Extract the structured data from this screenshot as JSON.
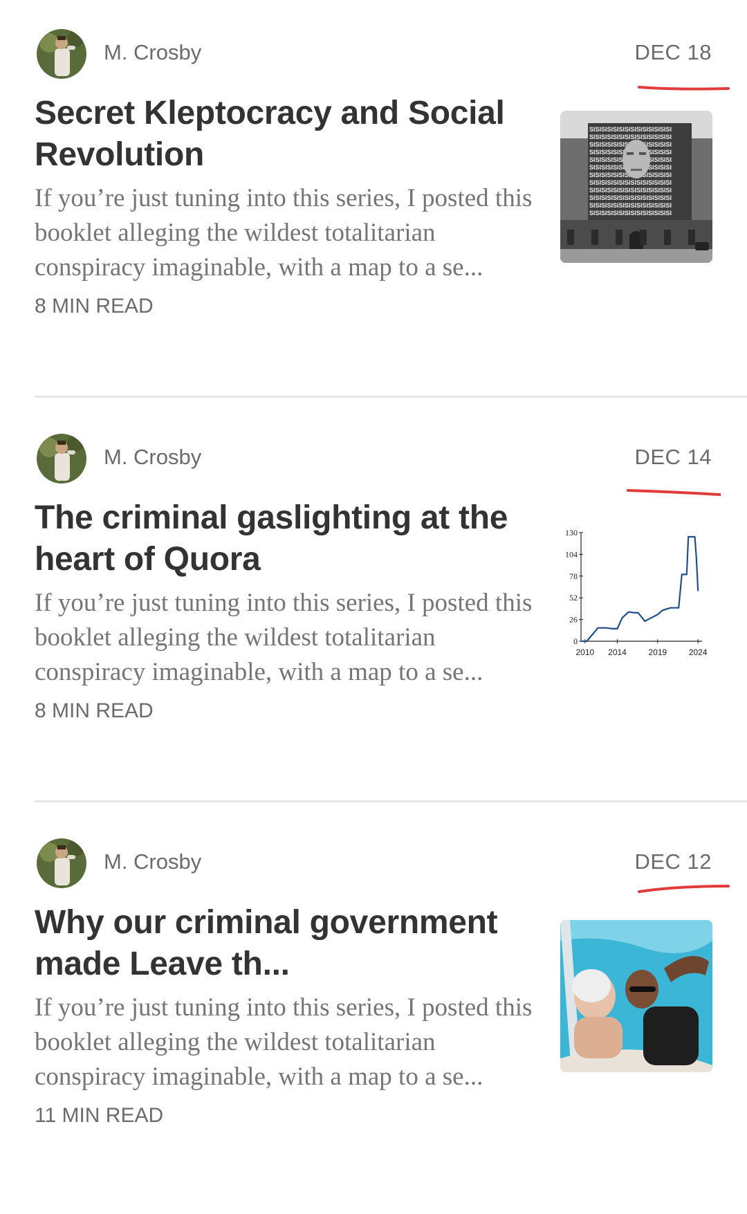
{
  "feed": {
    "posts": [
      {
        "author": "M. Crosby",
        "date": "DEC 18",
        "title": "Secret Kleptocracy and Social Revolution",
        "excerpt": "If you’re just tuning into this series, I posted this booklet alleging the wildest totalitarian conspiracy imaginable, with a map to a se...",
        "read_time": "8 MIN READ",
        "thumbnail_icon": "building-facade-photo"
      },
      {
        "author": "M. Crosby",
        "date": "DEC 14",
        "title": "The criminal gaslighting at the heart of Quora",
        "excerpt": "If you’re just tuning into this series, I posted this booklet alleging the wildest totalitarian conspiracy imaginable, with a map to a se...",
        "read_time": "8 MIN READ",
        "thumbnail_icon": "line-chart"
      },
      {
        "author": "M. Crosby",
        "date": "DEC 12",
        "title": "Why our criminal government made Leave th...",
        "excerpt": "If you’re just tuning into this series, I posted this booklet alleging the wildest totalitarian conspiracy imaginable, with a map to a se...",
        "read_time": "11 MIN READ",
        "thumbnail_icon": "people-in-pool-photo"
      }
    ]
  },
  "building_facade_text": "SI",
  "annotation_color": "#e23b3b",
  "chart_data": {
    "type": "line",
    "title": "",
    "xlabel": "",
    "ylabel": "",
    "x_ticks": [
      "2010",
      "2014",
      "2019",
      "2024"
    ],
    "y_ticks": [
      "0",
      "26",
      "52",
      "78",
      "104",
      "130"
    ],
    "xlim": [
      2009.5,
      2024.5
    ],
    "ylim": [
      0,
      130
    ],
    "series": [
      {
        "x": [
          2009.6,
          2010.2,
          2011.0,
          2011.6,
          2012.6,
          2013.4,
          2014.0,
          2014.6,
          2015.4,
          2016.2,
          2016.6,
          2017.4,
          2018.2,
          2019.0,
          2019.6,
          2020.6,
          2021.6,
          2022.0,
          2022.6,
          2022.8,
          2023.6,
          2023.8,
          2024.0
        ],
        "values": [
          0,
          0,
          9,
          16,
          16,
          15,
          15,
          28,
          35,
          34,
          34,
          24,
          28,
          32,
          37,
          40,
          40,
          80,
          80,
          125,
          125,
          100,
          60
        ]
      }
    ]
  }
}
